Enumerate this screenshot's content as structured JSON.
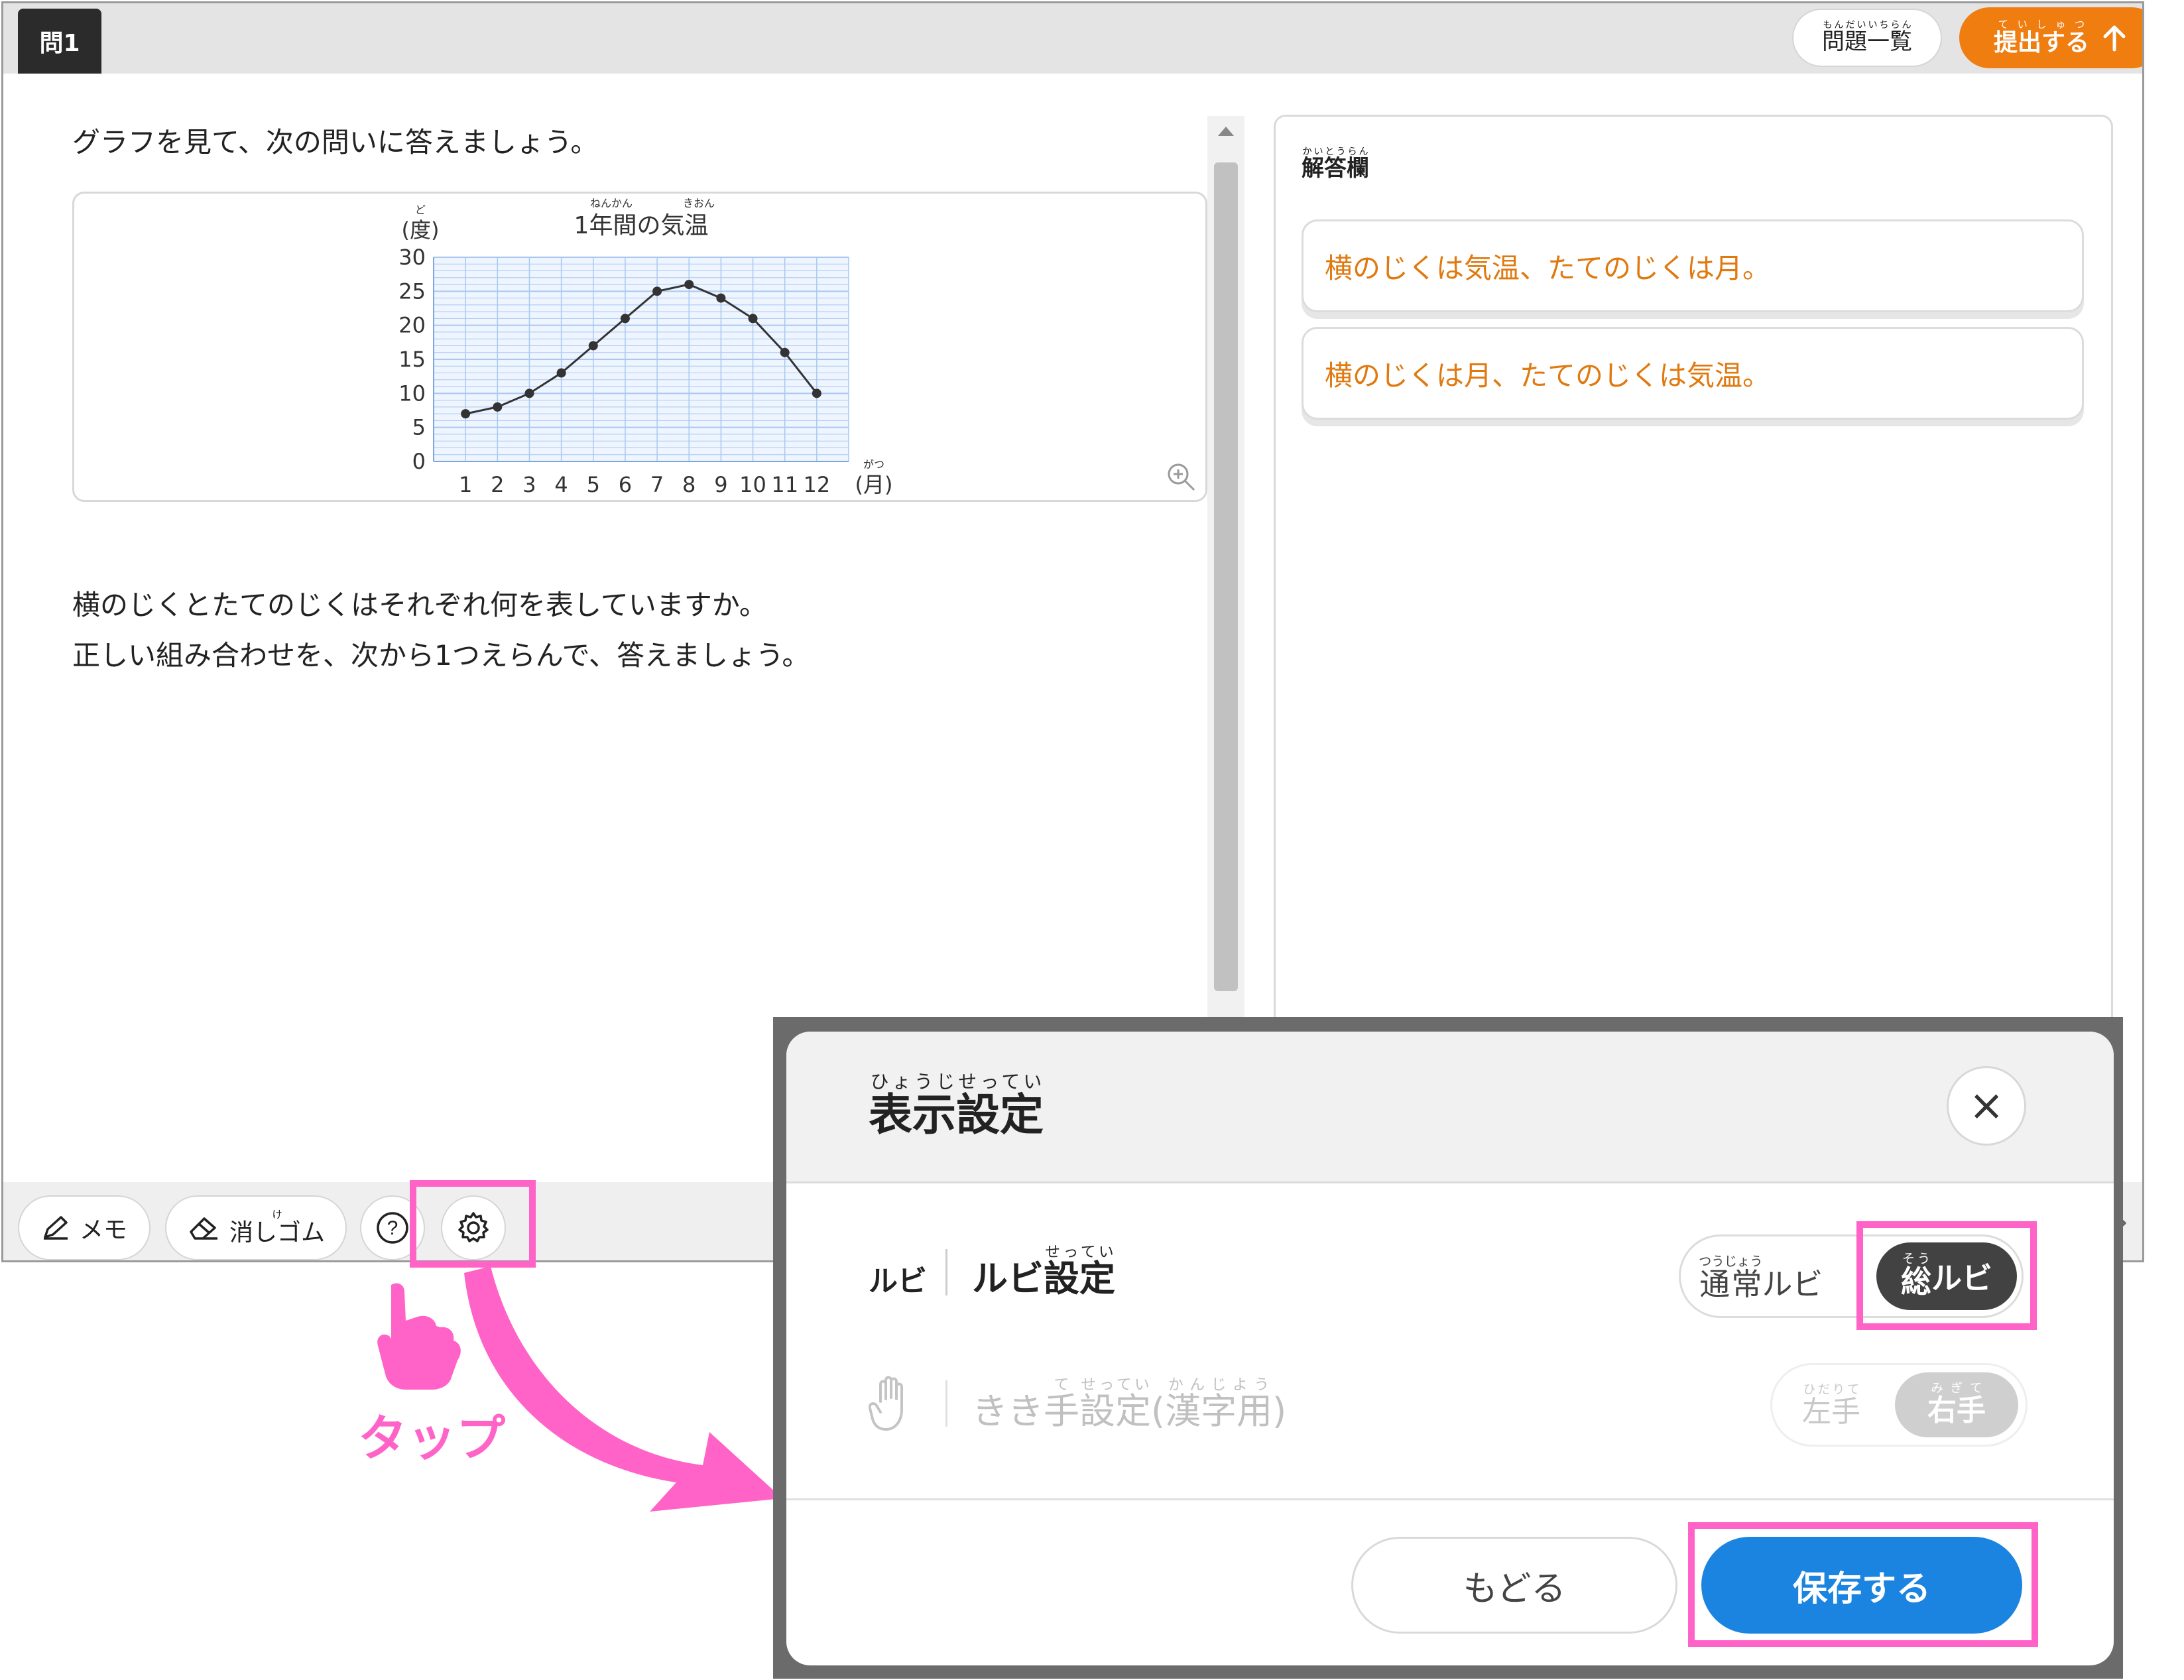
{
  "header": {
    "question_badge": "問1",
    "list_button": {
      "label": "問題一覧",
      "ruby": "もんだいいちらん"
    },
    "submit_button": {
      "label": "提出する",
      "ruby": "ていしゅつ",
      "icon": "arrow-up-icon"
    }
  },
  "question": {
    "instruction": "グラフを見て、次の問いに答えましょう。",
    "body_line1": "横のじくとたてのじくはそれぞれ何を表していますか。",
    "body_line2": "正しい組み合わせを、次から1つえらんで、答えましょう。"
  },
  "chart_data": {
    "type": "line",
    "title": "1年間の気温",
    "title_ruby": {
      "年間": "ねんかん",
      "気温": "きおん"
    },
    "ylabel": "(度)",
    "ylabel_ruby": "ど",
    "xlabel": "(月)",
    "xlabel_ruby": "がつ",
    "categories": [
      "1",
      "2",
      "3",
      "4",
      "5",
      "6",
      "7",
      "8",
      "9",
      "10",
      "11",
      "12"
    ],
    "values": [
      7,
      8,
      10,
      13,
      17,
      21,
      25,
      26,
      24,
      21,
      16,
      10
    ],
    "ylim": [
      0,
      30
    ],
    "yticks": [
      "0",
      "5",
      "10",
      "15",
      "20",
      "25",
      "30"
    ],
    "grid": true,
    "color": "#333333",
    "grid_color": "#a9c8f0"
  },
  "answer": {
    "title": "解答欄",
    "title_ruby": "かいとうらん",
    "choices": [
      "横のじくは気温、たてのじくは月。",
      "横のじくは月、たてのじくは気温。"
    ]
  },
  "toolbar": {
    "memo_label": "メモ",
    "eraser_label": "消しゴム",
    "eraser_ruby": "け",
    "help_label": "?"
  },
  "callout": {
    "tap_label": "タップ"
  },
  "modal": {
    "title": "表示設定",
    "title_ruby": "ひょうじせってい",
    "close_label": "×",
    "ruby_setting": {
      "icon_label": "ルビ",
      "label": "ルビ設定",
      "label_ruby": "せってい",
      "option_normal": "通常ルビ",
      "option_normal_ruby": "つうじょう",
      "option_all": "総ルビ",
      "option_all_ruby": "そう"
    },
    "hand_setting": {
      "label": "きき手設定(漢字用)",
      "label_ruby_te": "て",
      "label_ruby_settei": "せってい",
      "label_ruby_kanji": "かんじよう",
      "option_left": "左手",
      "option_left_ruby": "ひだりて",
      "option_right": "右手",
      "option_right_ruby": "みぎて"
    },
    "back_button": "もどる",
    "save_button": "保存する"
  },
  "colors": {
    "accent_orange": "#ef7d10",
    "highlight_pink": "#ff63c8",
    "save_blue": "#1a84e0"
  }
}
